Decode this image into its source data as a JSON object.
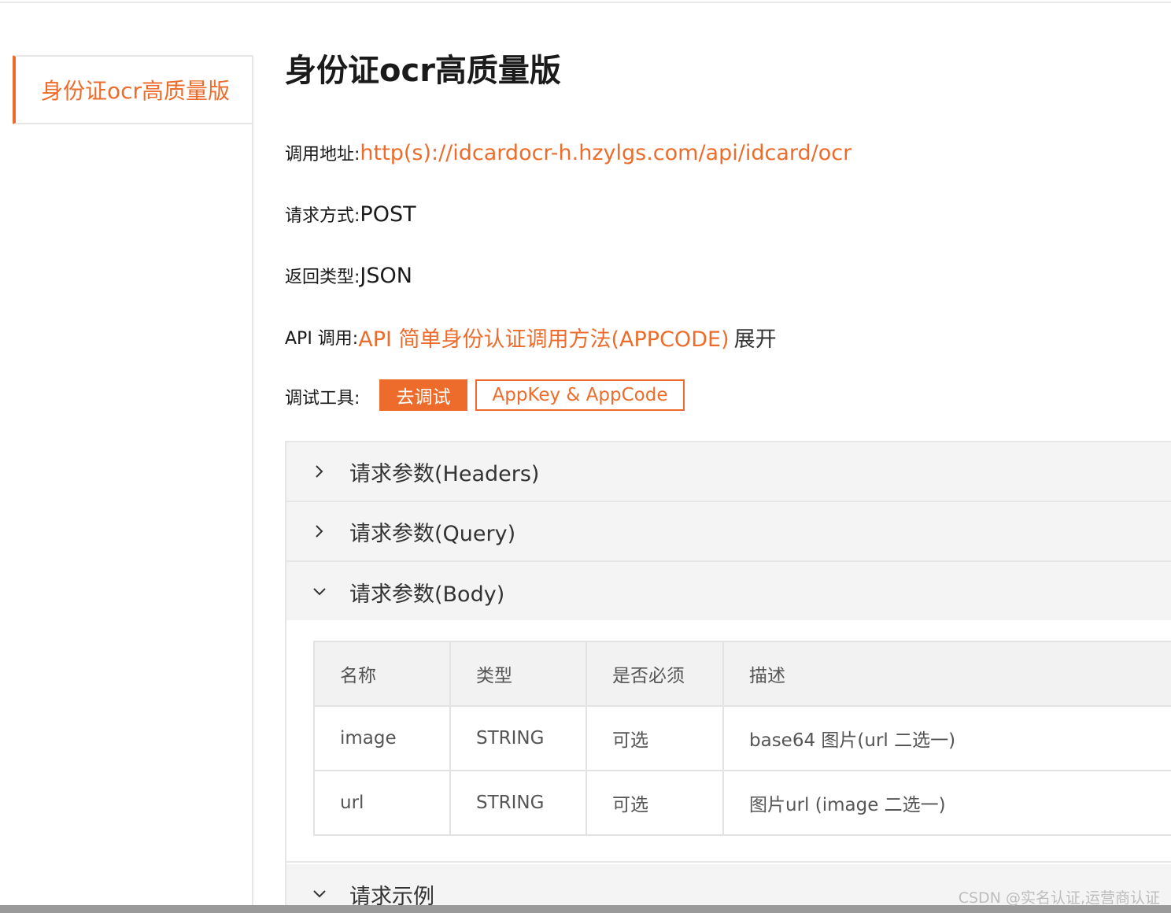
{
  "sidebar": {
    "active_item": "身份证ocr高质量版"
  },
  "title": "身份证ocr高质量版",
  "info": {
    "endpoint_label": "调用地址:",
    "endpoint_url": "http(s)://idcardocr-h.hzylgs.com/api/idcard/ocr",
    "method_label": "请求方式:",
    "method_value": "POST",
    "return_label": "返回类型:",
    "return_value": "JSON",
    "api_label": "API 调用:",
    "api_link": "API 简单身份认证调用方法(APPCODE)",
    "api_expand": "展开",
    "debug_label": "调试工具:",
    "debug_button": "去调试",
    "appkey_button": "AppKey & AppCode"
  },
  "sections": [
    {
      "title": "请求参数(Headers)",
      "state": "collapsed"
    },
    {
      "title": "请求参数(Query)",
      "state": "collapsed"
    },
    {
      "title": "请求参数(Body)",
      "state": "expanded"
    },
    {
      "title": "请求示例",
      "state": "expanded"
    }
  ],
  "body_table": {
    "headers": [
      "名称",
      "类型",
      "是否必须",
      "描述"
    ],
    "rows": [
      [
        "image",
        "STRING",
        "可选",
        "base64 图片(url 二选一)"
      ],
      [
        "url",
        "STRING",
        "可选",
        "图片url (image 二选一)"
      ]
    ]
  },
  "watermark": "CSDN @实名认证,运营商认证",
  "colors": {
    "accent": "#ed6c2b",
    "header_bg": "#f4f4f4",
    "border": "#e6e6e6"
  },
  "icons": {
    "collapsed": "chevron-right-icon",
    "expanded": "chevron-down-icon"
  }
}
